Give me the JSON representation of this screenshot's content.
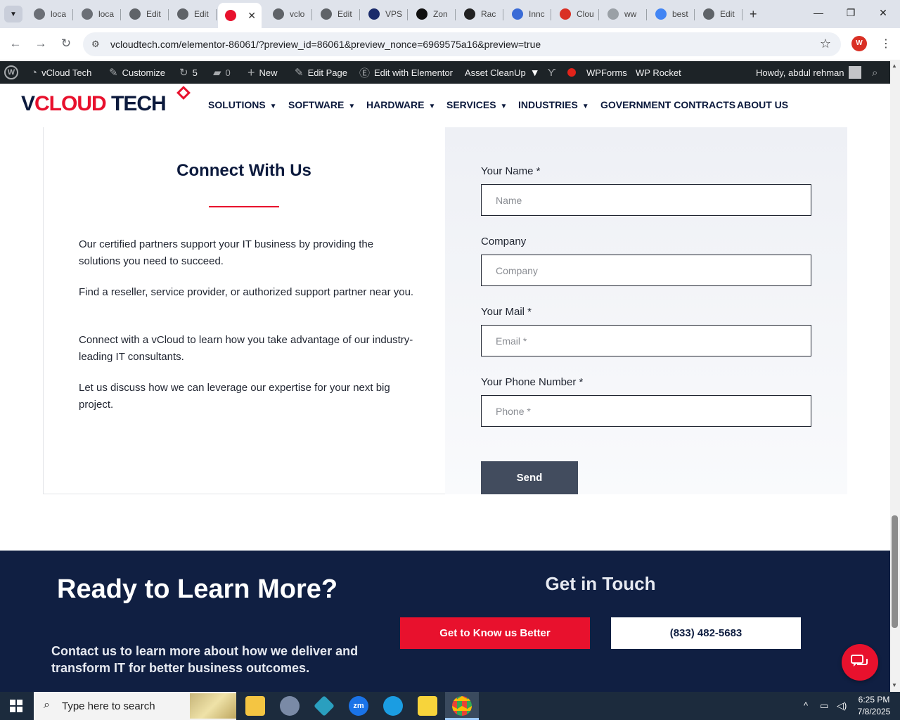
{
  "browser": {
    "tabs": [
      {
        "label": "loca",
        "icon": "wp-local-icon",
        "color": "#6b6f76"
      },
      {
        "label": "loca",
        "icon": "wp-local-icon",
        "color": "#6b6f76"
      },
      {
        "label": "Edit",
        "icon": "globe-icon",
        "color": "#5f6368"
      },
      {
        "label": "Edit",
        "icon": "globe-icon",
        "color": "#5f6368"
      },
      {
        "label": "",
        "icon": "vcloud-icon",
        "color": "#e8112d",
        "active": true
      },
      {
        "label": "vclo",
        "icon": "globe-icon",
        "color": "#5f6368"
      },
      {
        "label": "Edit",
        "icon": "globe-icon",
        "color": "#5f6368"
      },
      {
        "label": "VPS",
        "icon": "vps-icon",
        "color": "#1a2b6b"
      },
      {
        "label": "Zon",
        "icon": "z-icon",
        "color": "#111111"
      },
      {
        "label": "Rac",
        "icon": "rack-icon",
        "color": "#222222"
      },
      {
        "label": "Innc",
        "icon": "inno-icon",
        "color": "#3a6bd6"
      },
      {
        "label": "Clou",
        "icon": "cloud-sign-icon",
        "color": "#d93025"
      },
      {
        "label": "ww",
        "icon": "loading-icon",
        "color": "#9aa0a6"
      },
      {
        "label": "best",
        "icon": "google-icon",
        "color": "#4285f4"
      },
      {
        "label": "Edit",
        "icon": "globe-icon",
        "color": "#5f6368"
      }
    ],
    "url": "vcloudtech.com/elementor-86061/?preview_id=86061&preview_nonce=6969575a16&preview=true",
    "profile_initial": "W"
  },
  "wpbar": {
    "site": "vCloud Tech",
    "customize": "Customize",
    "updates": "5",
    "comments": "0",
    "new": "New",
    "edit_page": "Edit Page",
    "edit_elementor": "Edit with Elementor",
    "asset_cleanup": "Asset CleanUp",
    "wpforms": "WPForms",
    "wp_rocket": "WP Rocket",
    "howdy": "Howdy, abdul rehman"
  },
  "site": {
    "logo": {
      "v": "V",
      "cloud": "CLOUD",
      "tech": " TECH"
    },
    "nav": [
      {
        "label": "SOLUTIONS",
        "dropdown": true
      },
      {
        "label": "SOFTWARE",
        "dropdown": true
      },
      {
        "label": "HARDWARE",
        "dropdown": true
      },
      {
        "label": "SERVICES",
        "dropdown": true
      },
      {
        "label": "INDUSTRIES",
        "dropdown": true
      },
      {
        "label": "GOVERNMENT CONTRACTS",
        "dropdown": false
      },
      {
        "label": "ABOUT US",
        "dropdown": false
      }
    ]
  },
  "connect": {
    "title": "Connect With Us",
    "paragraphs": [
      "Our certified partners support your IT business by providing the solutions you need to succeed.",
      "Find a reseller, service provider, or authorized support partner near you.",
      "Connect with a vCloud to learn how you take advantage of our industry-leading IT consultants.",
      "Let us discuss how we can leverage our expertise for your next big project."
    ]
  },
  "form": {
    "name_label": "Your Name *",
    "name_placeholder": "Name",
    "company_label": "Company",
    "company_placeholder": "Company",
    "mail_label": "Your Mail *",
    "mail_placeholder": "Email *",
    "phone_label": "Your Phone Number *",
    "phone_placeholder": "Phone *",
    "send": "Send"
  },
  "cta": {
    "title": "Ready to Learn More?",
    "text": "Contact us to learn more about how we deliver and transform IT for better business outcomes.",
    "subtitle": "Get in Touch",
    "know_us": "Get to Know us Better",
    "phone": "(833) 482-5683"
  },
  "taskbar": {
    "search_placeholder": "Type here to search",
    "time": "6:25 PM",
    "date": "7/8/2025"
  },
  "colors": {
    "brand_navy": "#101f42",
    "brand_red": "#e8112d",
    "send_button": "#424c5e"
  }
}
